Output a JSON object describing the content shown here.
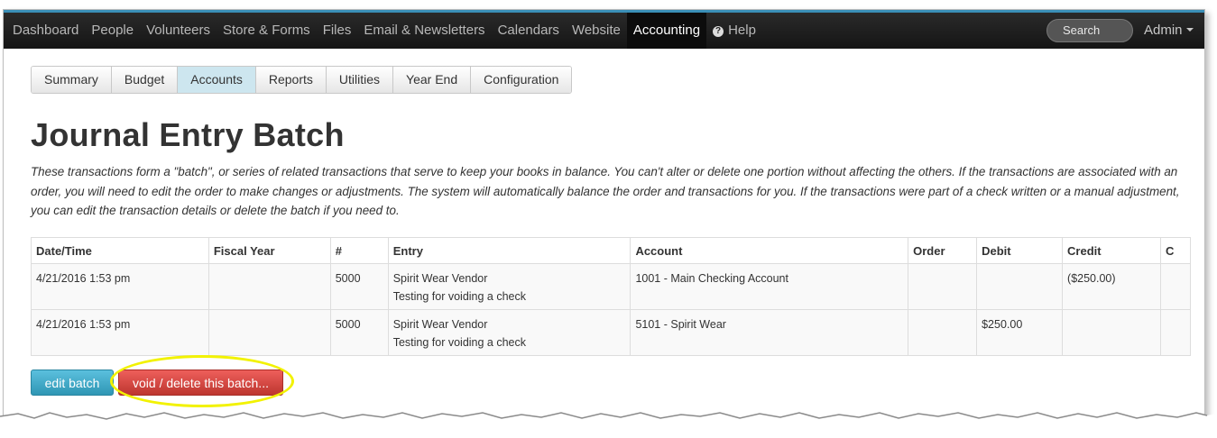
{
  "nav": {
    "items": [
      "Dashboard",
      "People",
      "Volunteers",
      "Store & Forms",
      "Files",
      "Email & Newsletters",
      "Calendars",
      "Website",
      "Accounting"
    ],
    "help_label": "Help",
    "help_icon": "question-circle-icon",
    "search_label": "Search",
    "admin_label": "Admin"
  },
  "subnav": {
    "tabs": [
      "Summary",
      "Budget",
      "Accounts",
      "Reports",
      "Utilities",
      "Year End",
      "Configuration"
    ],
    "active": "Accounts"
  },
  "page": {
    "title": "Journal Entry Batch",
    "description": "These transactions form a \"batch\", or series of related transactions that serve to keep your books in balance. You can't alter or delete one portion without affecting the others. If the transactions are associated with an order, you will need to edit the order to make changes or adjustments. The system will automatically balance the order and transactions for you. If the transactions were part of a check written or a manual adjustment, you can edit the transaction details or delete the batch if you need to."
  },
  "table": {
    "headers": [
      "Date/Time",
      "Fiscal Year",
      "#",
      "Entry",
      "Account",
      "Order",
      "Debit",
      "Credit",
      "C"
    ],
    "rows": [
      {
        "datetime": "4/21/2016 1:53 pm",
        "fiscal_year": "",
        "number": "5000",
        "entry_line1": "Spirit Wear Vendor",
        "entry_line2": "Testing for voiding a check",
        "account": "1001 - Main Checking Account",
        "order": "",
        "debit": "",
        "credit": "($250.00)",
        "c": ""
      },
      {
        "datetime": "4/21/2016 1:53 pm",
        "fiscal_year": "",
        "number": "5000",
        "entry_line1": "Spirit Wear Vendor",
        "entry_line2": "Testing for voiding a check",
        "account": "5101 - Spirit Wear",
        "order": "",
        "debit": "$250.00",
        "credit": "",
        "c": ""
      }
    ]
  },
  "actions": {
    "edit_label": "edit batch",
    "void_label": "void / delete this batch..."
  },
  "colors": {
    "topbar": "#1b1b1b",
    "accent_border": "#3a8fb7",
    "active_subtab": "#cde6ef",
    "edit_button": "#49afcd",
    "void_button": "#da4f49",
    "highlight": "#f2f200"
  }
}
